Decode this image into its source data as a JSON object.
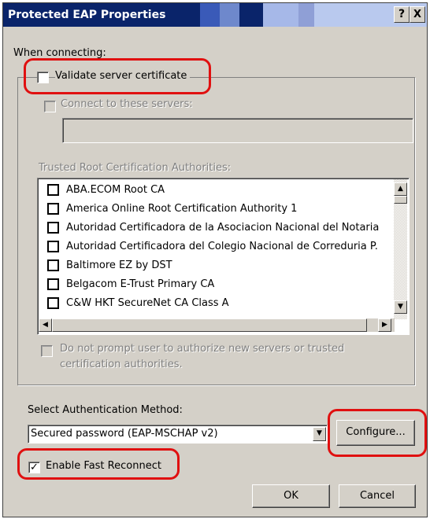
{
  "window": {
    "title": "Protected EAP Properties",
    "help_button": "?",
    "close_button": "X"
  },
  "connect": {
    "section_label": "When connecting:",
    "validate_cert_label": "Validate server certificate",
    "validate_cert_checked": false,
    "connect_servers_label": "Connect to these servers:",
    "servers_value": ""
  },
  "trusted": {
    "label": "Trusted Root Certification Authorities:",
    "items": [
      "ABA.ECOM Root CA",
      "America Online Root Certification Authority 1",
      "Autoridad Certificadora de la Asociacion Nacional del Notaria",
      "Autoridad Certificadora del Colegio Nacional de Correduria P.",
      "Baltimore EZ by DST",
      "Belgacom E-Trust Primary CA",
      "C&W HKT SecureNet CA Class A"
    ]
  },
  "prompt": {
    "line1": "Do not prompt user to authorize new servers or trusted",
    "line2": "certification authorities."
  },
  "auth": {
    "label": "Select Authentication Method:",
    "selected": "Secured password (EAP-MSCHAP v2)",
    "configure_label": "Configure...",
    "fast_reconnect_label": "Enable Fast Reconnect",
    "fast_reconnect_checked": true
  },
  "footer": {
    "ok_label": "OK",
    "cancel_label": "Cancel"
  },
  "colors": {
    "annotation_red": "#e01010",
    "titlebar_blue": "#0a246a"
  }
}
